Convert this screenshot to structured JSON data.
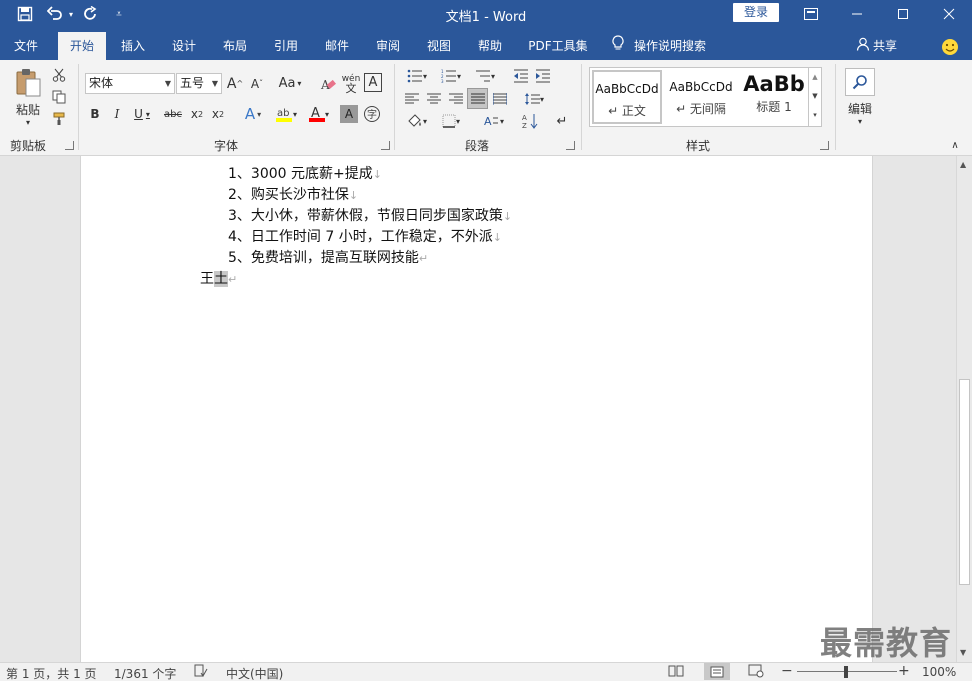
{
  "window": {
    "title": "文档1  -  Word",
    "login_label": "登录"
  },
  "tabs": [
    {
      "label": "文件"
    },
    {
      "label": "开始"
    },
    {
      "label": "插入"
    },
    {
      "label": "设计"
    },
    {
      "label": "布局"
    },
    {
      "label": "引用"
    },
    {
      "label": "邮件"
    },
    {
      "label": "审阅"
    },
    {
      "label": "视图"
    },
    {
      "label": "帮助"
    },
    {
      "label": "PDF工具集"
    }
  ],
  "active_tab": "开始",
  "tell_me": "操作说明搜索",
  "share_label": "共享",
  "ribbon": {
    "clipboard": {
      "label": "剪贴板",
      "paste_label": "粘贴"
    },
    "font": {
      "label": "字体",
      "font_name": "宋体",
      "font_size": "五号"
    },
    "paragraph": {
      "label": "段落"
    },
    "styles": {
      "label": "样式",
      "items": [
        {
          "sample": "AaBbCcDd",
          "name": "↵ 正文"
        },
        {
          "sample": "AaBbCcDd",
          "name": "↵ 无间隔"
        },
        {
          "sample": "AaBb",
          "name": "标题 1"
        }
      ]
    },
    "editing": {
      "label": "编辑"
    }
  },
  "document": {
    "lines": [
      {
        "text": "1、3000 元底薪+提成",
        "mark": "↓"
      },
      {
        "text": "2、购买长沙市社保",
        "mark": "↓"
      },
      {
        "text": "3、大小休，带薪休假，节假日同步国家政策",
        "mark": "↓"
      },
      {
        "text": "4、日工作时间 7 小时，工作稳定，不外派",
        "mark": "↓"
      },
      {
        "text": "5、免费培训，提高互联网技能",
        "mark": "↵"
      }
    ],
    "signature_part1": "王",
    "signature_part2": "土",
    "signature_mark": "↵"
  },
  "watermark": "最需教育",
  "status": {
    "page": "第 1 页，共 1 页",
    "words": "1/361 个字",
    "language": "中文(中国)",
    "zoom": "100%",
    "zoom_minus": "−",
    "zoom_plus": "+"
  },
  "colors": {
    "brand": "#2b579a",
    "highlight": "#ffff00",
    "font_color": "#ff0000"
  }
}
